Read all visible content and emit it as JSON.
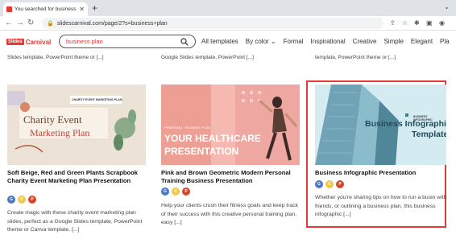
{
  "browser": {
    "tab_title": "You searched for business plan",
    "url": "slidescarnival.com/page/2?s=business+plan"
  },
  "site": {
    "logo_box": "Slides",
    "logo_word": "Carnival",
    "search_value": "business plan",
    "menu": [
      "All templates",
      "By color ⌄",
      "Formal",
      "Inspirational",
      "Creative",
      "Simple",
      "Elegant",
      "Pla"
    ]
  },
  "previous_row": [
    "Slides template, PowerPoint theme or [...]",
    "Google Slides template, PowerPoint [...]",
    "template, PowerPoint theme or [...]"
  ],
  "cards": [
    {
      "title": "Soft Beige, Red and Green Plants Scrapbook Charity Event Marketing Plan Presentation",
      "thumb_tag": "CHARITY EVENT MARKETING PLAN",
      "thumb_line1": "Charity Event",
      "thumb_line2": "Marketing Plan",
      "description": "Create magic with these charity event marketing plan slides, perfect as a Google Slides template, PowerPoint theme or Canva template. [...]"
    },
    {
      "title": "Pink and Brown Geometric Modern Personal Training Business Presentation",
      "thumb_tag": "PERSONAL TRAINING PLAN",
      "thumb_line1": "YOUR HEALTHCARE",
      "thumb_line2": "PRESENTATION",
      "description": "Help your clients crush their fitness goals and keep track of their success with this creative personal training plan, easy [...]"
    },
    {
      "title": "Business Infographic Presentation",
      "thumb_tag": "BUSINESS INFOGRAPHIC",
      "thumb_line1": "Business Infographic",
      "thumb_line2": "Template",
      "description": "Whether you're sharing tips on how to run a busin with friends, or outlining a business plan, this business infographic [...]"
    }
  ],
  "badge_letters": {
    "google": "G",
    "canva": "C",
    "powerpoint": "P"
  },
  "colors": {
    "accent": "#e53935",
    "google": "#4a78c8",
    "canva": "#f2c84b",
    "powerpoint": "#d1492d"
  }
}
